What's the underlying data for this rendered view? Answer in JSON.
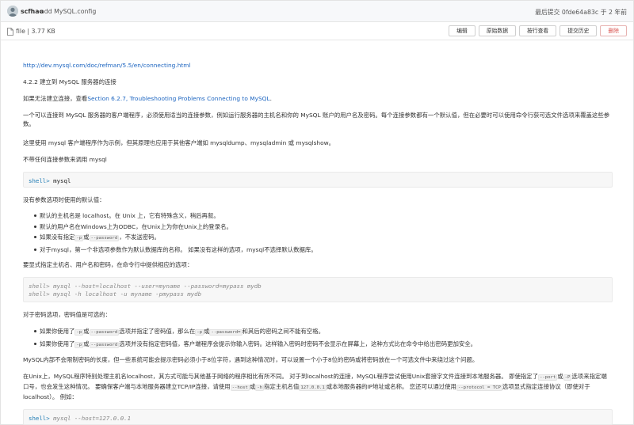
{
  "commit": {
    "author": "scfhao",
    "message": "add MySQL.config",
    "last_commit": "最后提交 0fde64a83c 于 2 年前"
  },
  "file": {
    "info": "file | 3.77 KB",
    "buttons": [
      "编辑",
      "原始数据",
      "按行查看",
      "提交历史",
      "删除"
    ]
  },
  "doc": {
    "url": "http://dev.mysql.com/doc/refman/5.5/en/connecting.html",
    "heading": "4.2.2 建立到 MySQL 服务器的连接",
    "p_fail_prefix": "如果无法建立连接，查看",
    "p_fail_link": "Section 6.2.7, Troubleshooting Problems Connecting to MySQL",
    "p_fail_suffix": ".",
    "p_intro": "一个可以连接到 MySQL 服务器的客户端程序，必须使用适当的连接参数，例如运行服务器的主机名和你的 MySQL 账户的用户名及密码。每个连接参数都有一个默认值，但在必要时可以使用命令行获可选文件选项来覆盖这些参数。",
    "p_example": "这里使用 mysql 客户端程序作为示例，但其原理也应用于其他客户端如 mysqldump、mysqladmin 或 mysqlshow。",
    "p_noparam": "不带任何连接参数来调用 mysql",
    "code1": {
      "prompt": "shell>",
      "cmd": " mysql"
    },
    "p_defaults": "没有参数选项时使用的默认值：",
    "defaults": [
      {
        "text": "默认的主机名是 localhost。在 Unix 上，它有特殊含义，稍后再叙。"
      },
      {
        "text": "默认的用户名在Windows上为ODBC，在Unix上为你在Unix上的登录名。"
      },
      {
        "pre": "如果没有指定",
        "c1": "-p",
        "mid": "或",
        "c2": "--password",
        "post": "，不发送密码。"
      },
      {
        "text": "对于mysql，第一个非选项参数作为默认数据库的名称。 如果没有这样的选项，mysql不选择默认数据库。"
      }
    ],
    "p_explicit": "要显式指定主机名、用户名和密码，在命令行中提供相应的选项：",
    "code2": {
      "line1": {
        "prompt": "shell>",
        "cmd": " mysql --host=localhost --user=myname --password=mypass mydb"
      },
      "line2": {
        "prompt": "shell>",
        "cmd": " mysql -h localhost -u myname -pmypass mydb"
      }
    },
    "p_pwd": "对于密码选项，密码值是可选的：",
    "pwd_items": [
      {
        "pre": "如果你使用了",
        "c1": "-p",
        "mid": "或",
        "c2": "--password",
        "mid2": "选项并指定了密码值，那么在",
        "c3": "-p",
        "mid3": "或",
        "c4": "--password=",
        "post": "和其后的密码之间不能有空格。"
      },
      {
        "pre": "如果你使用了",
        "c1": "-p",
        "mid": "或",
        "c2": "--password",
        "post": "选项并没有指定密码值，客户端程序会提示你输入密码。这样输入密码时密码不会显示在屏幕上，这种方式比在命令中给出密码更加安全。"
      }
    ],
    "p_limit": "MySQL内部不会限制密码的长度，但一些系统可能会提示密码必须小于8位字符，遇到这种情况时，可以设置一个小于8位的密码或将密码放在一个可选文件中来绕过这个问题。",
    "p_unix": {
      "a": "在Unix上，MySQL程序特别处理主机名localhost，其方式可能与其他基于网络的程序相比有所不同。 对于到localhost的连接，MySQL程序尝试使用Unix套接字文件连接到本地服务器。 即使指定了",
      "c1": "--port",
      "b": "或",
      "c2": "-P",
      "c": "选项来指定端口号，也会发生这种情况。 要确保客户端与本地服务器建立TCP/IP连接，请使用",
      "c3": "--host",
      "d": "或",
      "c4": "-h",
      "e": "指定主机名值",
      "c5": "127.0.0.1",
      "f": "或本地服务器的IP地址或名称。 您还可以通过使用",
      "c6": "--protocol = TCP",
      "g": "选项显式指定连接协议（即使对于localhost）。 例如："
    },
    "code3": {
      "prompt": "shell>",
      "cmd": " mysql --host=127.0.0.1"
    }
  }
}
